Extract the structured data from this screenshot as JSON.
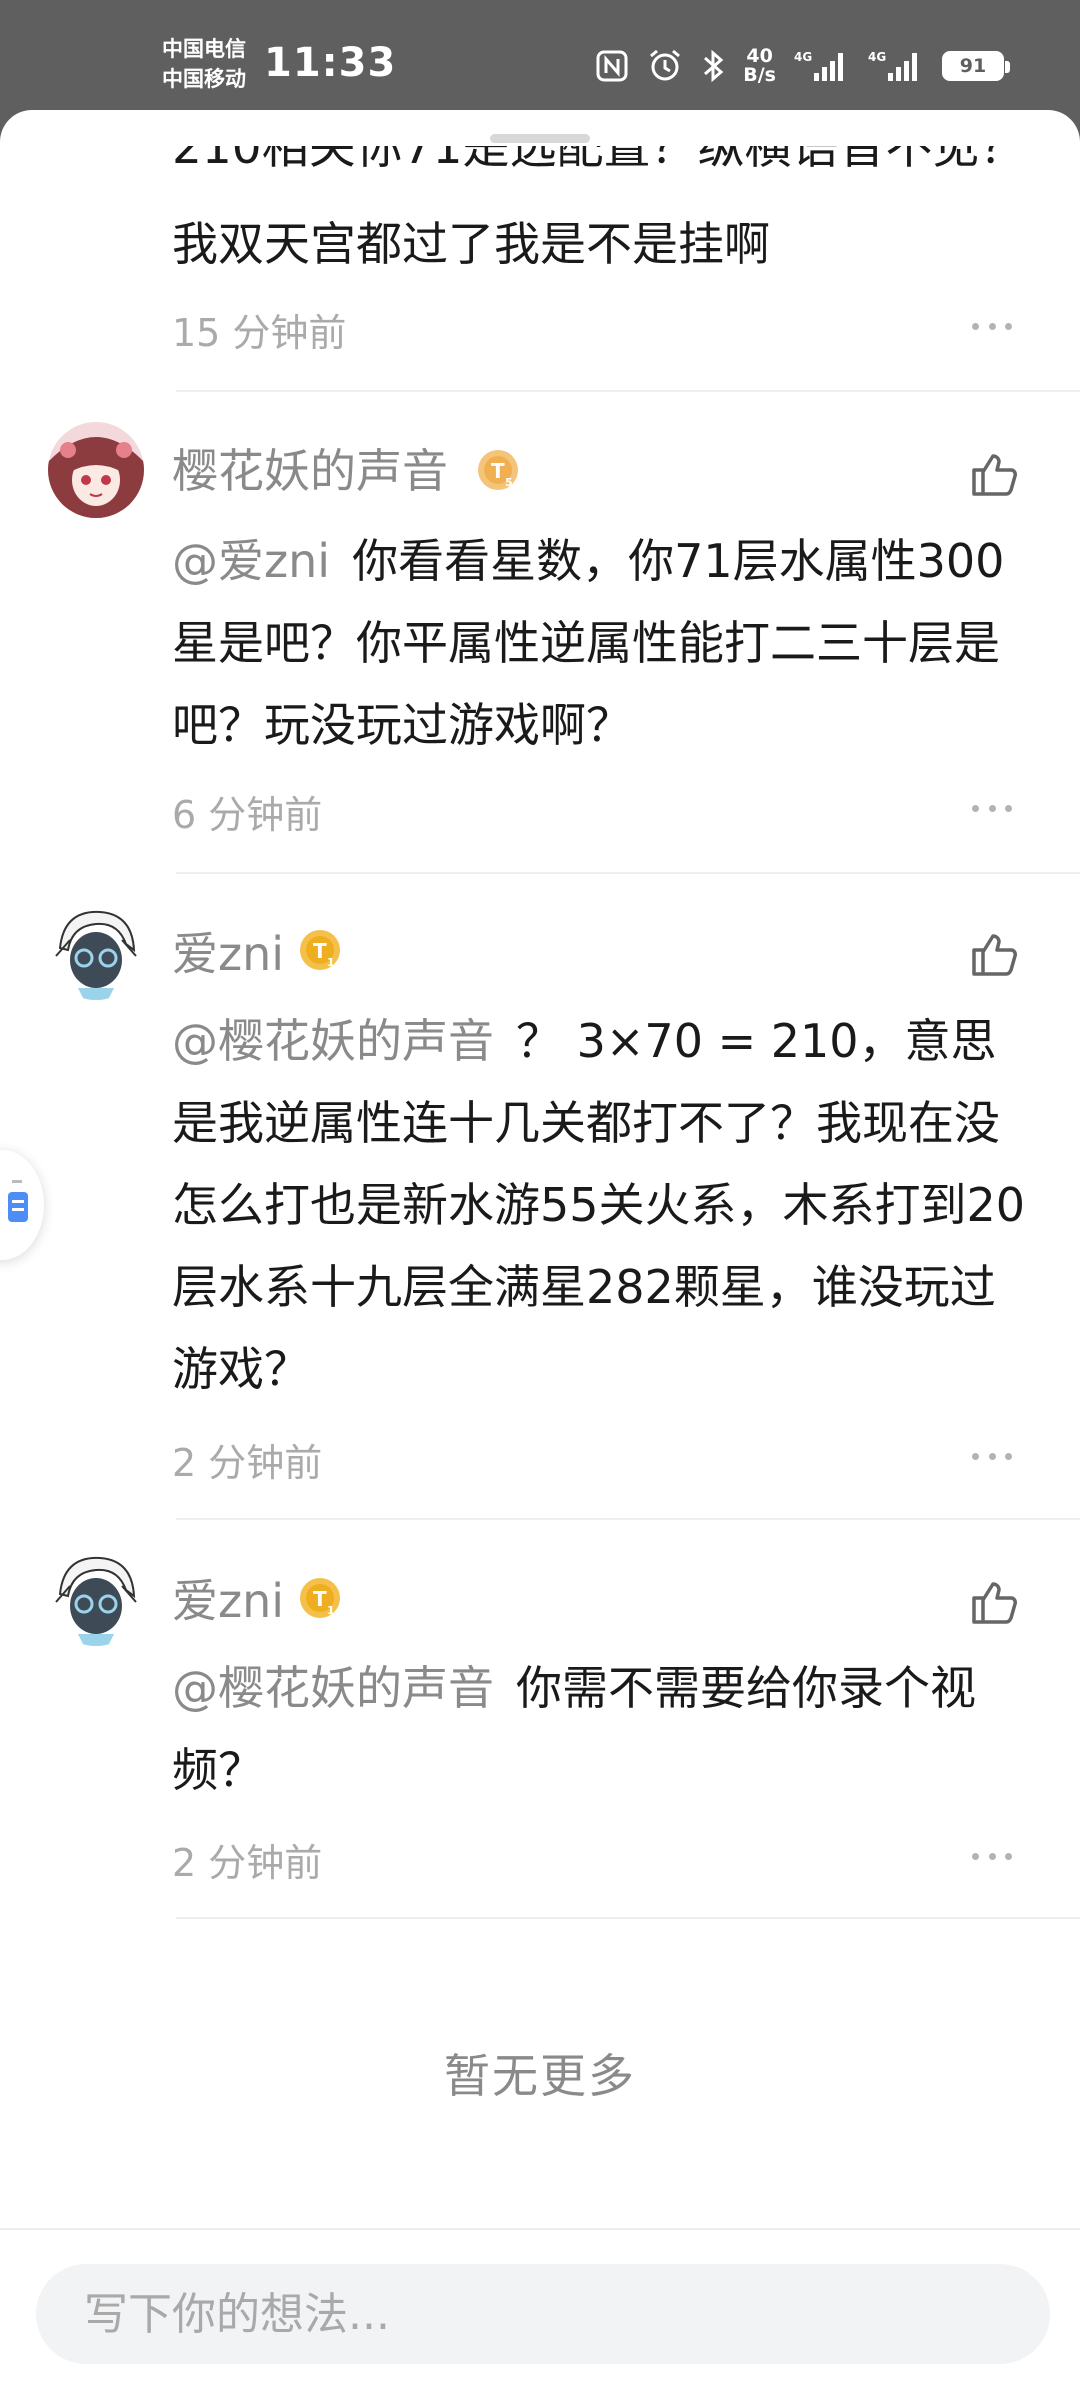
{
  "status_bar": {
    "carrier1": "中国电信",
    "carrier2": "中国移动",
    "time": "11:33",
    "net_speed_value": "40",
    "net_speed_unit": "B/s",
    "signal1_label": "4G",
    "signal2_label": "4G",
    "battery": "91"
  },
  "top_comment": {
    "cut_text": "210相关你71是选配置？纵横语音不见？",
    "text": "我双天宫都过了我是不是挂啊",
    "time": "15 分钟前"
  },
  "comments": [
    {
      "username": "樱花妖的声音",
      "level": "T5",
      "mention": "@爱zni",
      "text": "你看看星数，你71层水属性300星是吧？你平属性逆属性能打二三十层是吧？玩没玩过游戏啊？",
      "time": "6 分钟前"
    },
    {
      "username": "爱zni",
      "level": "T1",
      "mention": "@樱花妖的声音",
      "text": "？ 3×70 = 210，意思是我逆属性连十几关都打不了？我现在没怎么打也是新水游55关火系，木系打到20层水系十九层全满星282颗星，谁没玩过游戏？",
      "time": "2 分钟前"
    },
    {
      "username": "爱zni",
      "level": "T1",
      "mention": "@樱花妖的声音",
      "text": "你需不需要给你录个视频？",
      "time": "2 分钟前"
    }
  ],
  "no_more": "暂无更多",
  "composer": {
    "placeholder": "写下你的想法..."
  },
  "colors": {
    "status_bar_bg": "#5f5f5f",
    "badge_gold": "#f2b63c"
  }
}
